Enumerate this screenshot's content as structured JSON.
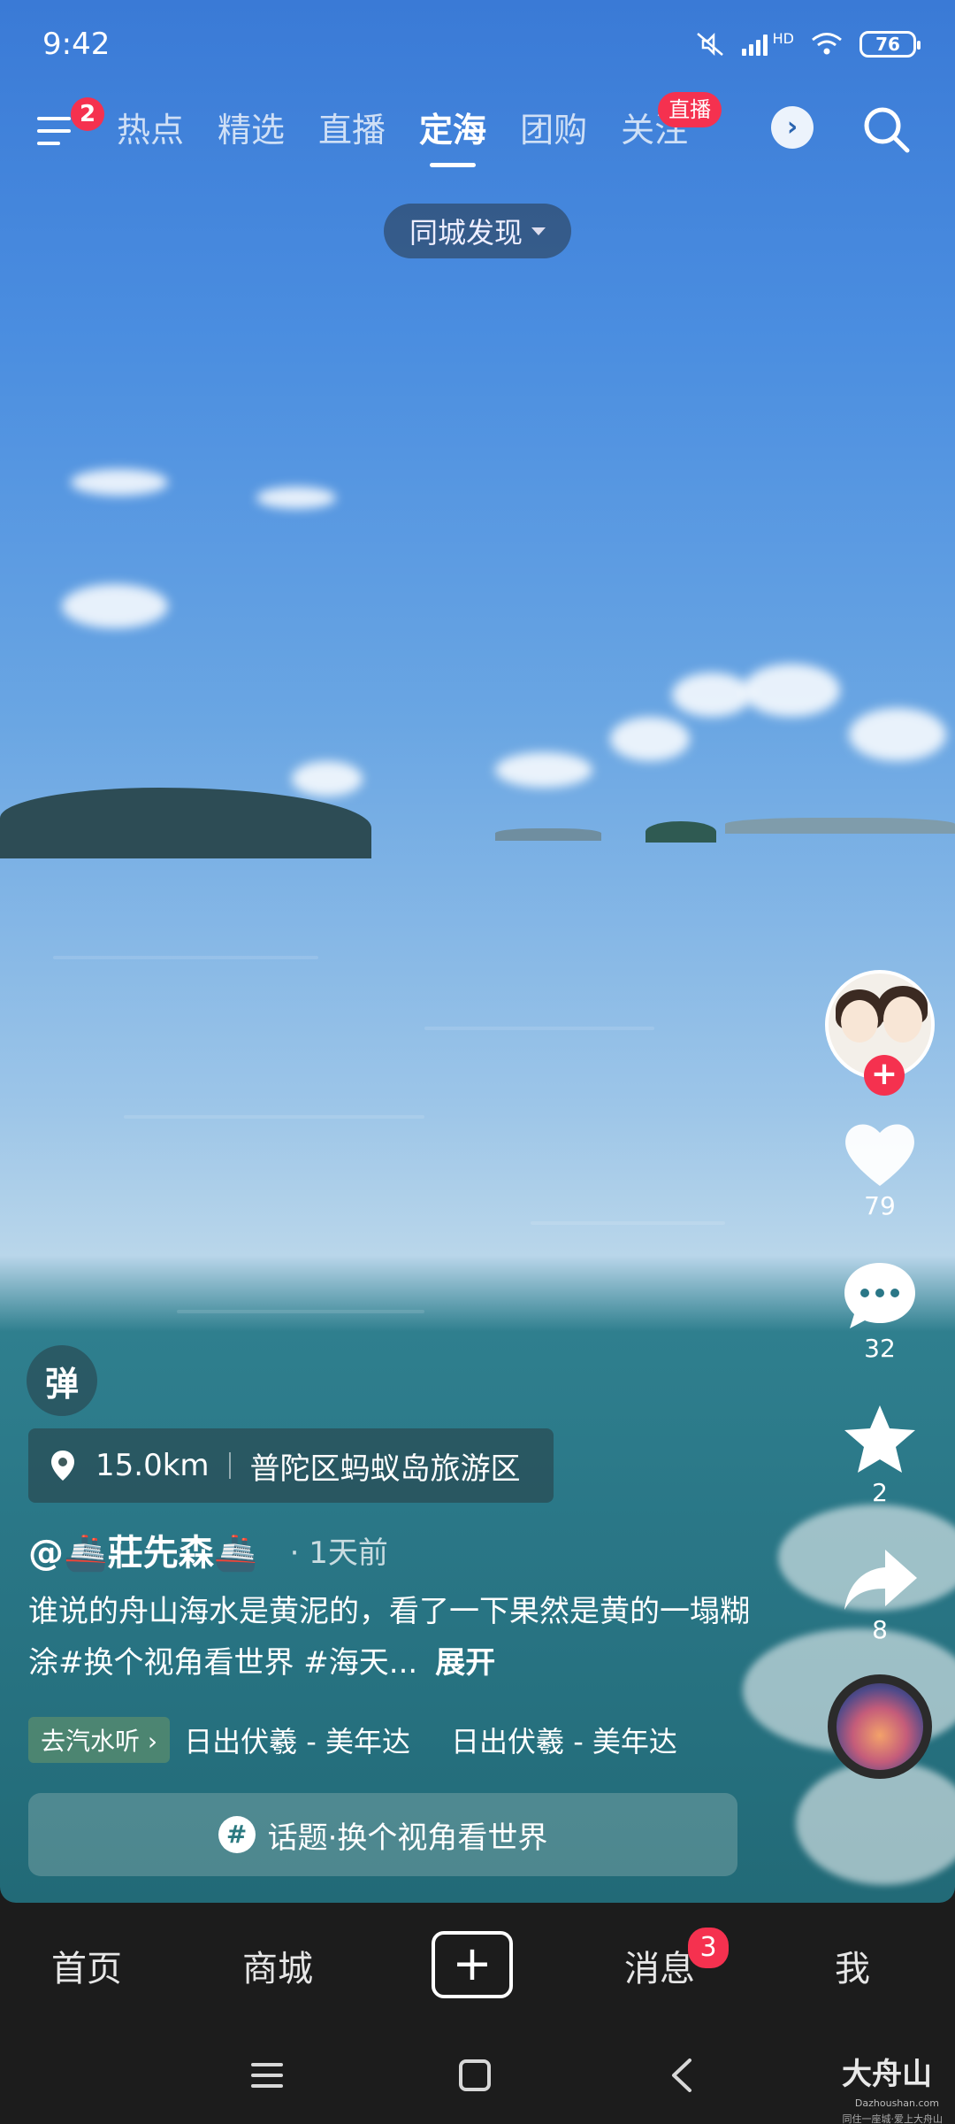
{
  "status_bar": {
    "time": "9:42",
    "network": "HD",
    "battery": "76"
  },
  "top_nav": {
    "menu_badge": "2",
    "tabs": [
      {
        "label": "热点"
      },
      {
        "label": "精选"
      },
      {
        "label": "直播"
      },
      {
        "label": "定海"
      },
      {
        "label": "团购"
      },
      {
        "label": "关注"
      }
    ],
    "active_tab": "定海",
    "live_badge": "直播",
    "more_icon": "chevron-right-icon",
    "search_icon": "search-icon"
  },
  "city_filter": {
    "label": "同城发现"
  },
  "right_rail": {
    "likes": "79",
    "comments": "32",
    "favorites": "2",
    "shares": "8",
    "follow_symbol": "+"
  },
  "danmu": {
    "label": "弹"
  },
  "location": {
    "distance": "15.0km",
    "place": "普陀区蚂蚁岛旅游区"
  },
  "author": {
    "name": "@🚢莊先森🚢",
    "time": "· 1天前"
  },
  "caption": {
    "text": "谁说的舟山海水是黄泥的，看了一下果然是黄的一塌糊涂#换个视角看世界 #海天...",
    "expand": "展开"
  },
  "music": {
    "tag": "去汽水听 ›",
    "track_1": "日出伏羲 - 美年达",
    "track_2": "日出伏羲 - 美年达"
  },
  "topic": {
    "label": "话题·换个视角看世界",
    "icon": "#"
  },
  "bottom_nav": {
    "home": "首页",
    "mall": "商城",
    "create": "+",
    "messages": "消息",
    "messages_badge": "3",
    "me": "我"
  },
  "watermark": {
    "brand": "大舟山",
    "domain": "Dazhoushan.com",
    "slogan": "同住一座城·爱上大舟山"
  },
  "colors": {
    "accent_red": "#f5314f",
    "nav_bg": "#1c1c1c"
  }
}
